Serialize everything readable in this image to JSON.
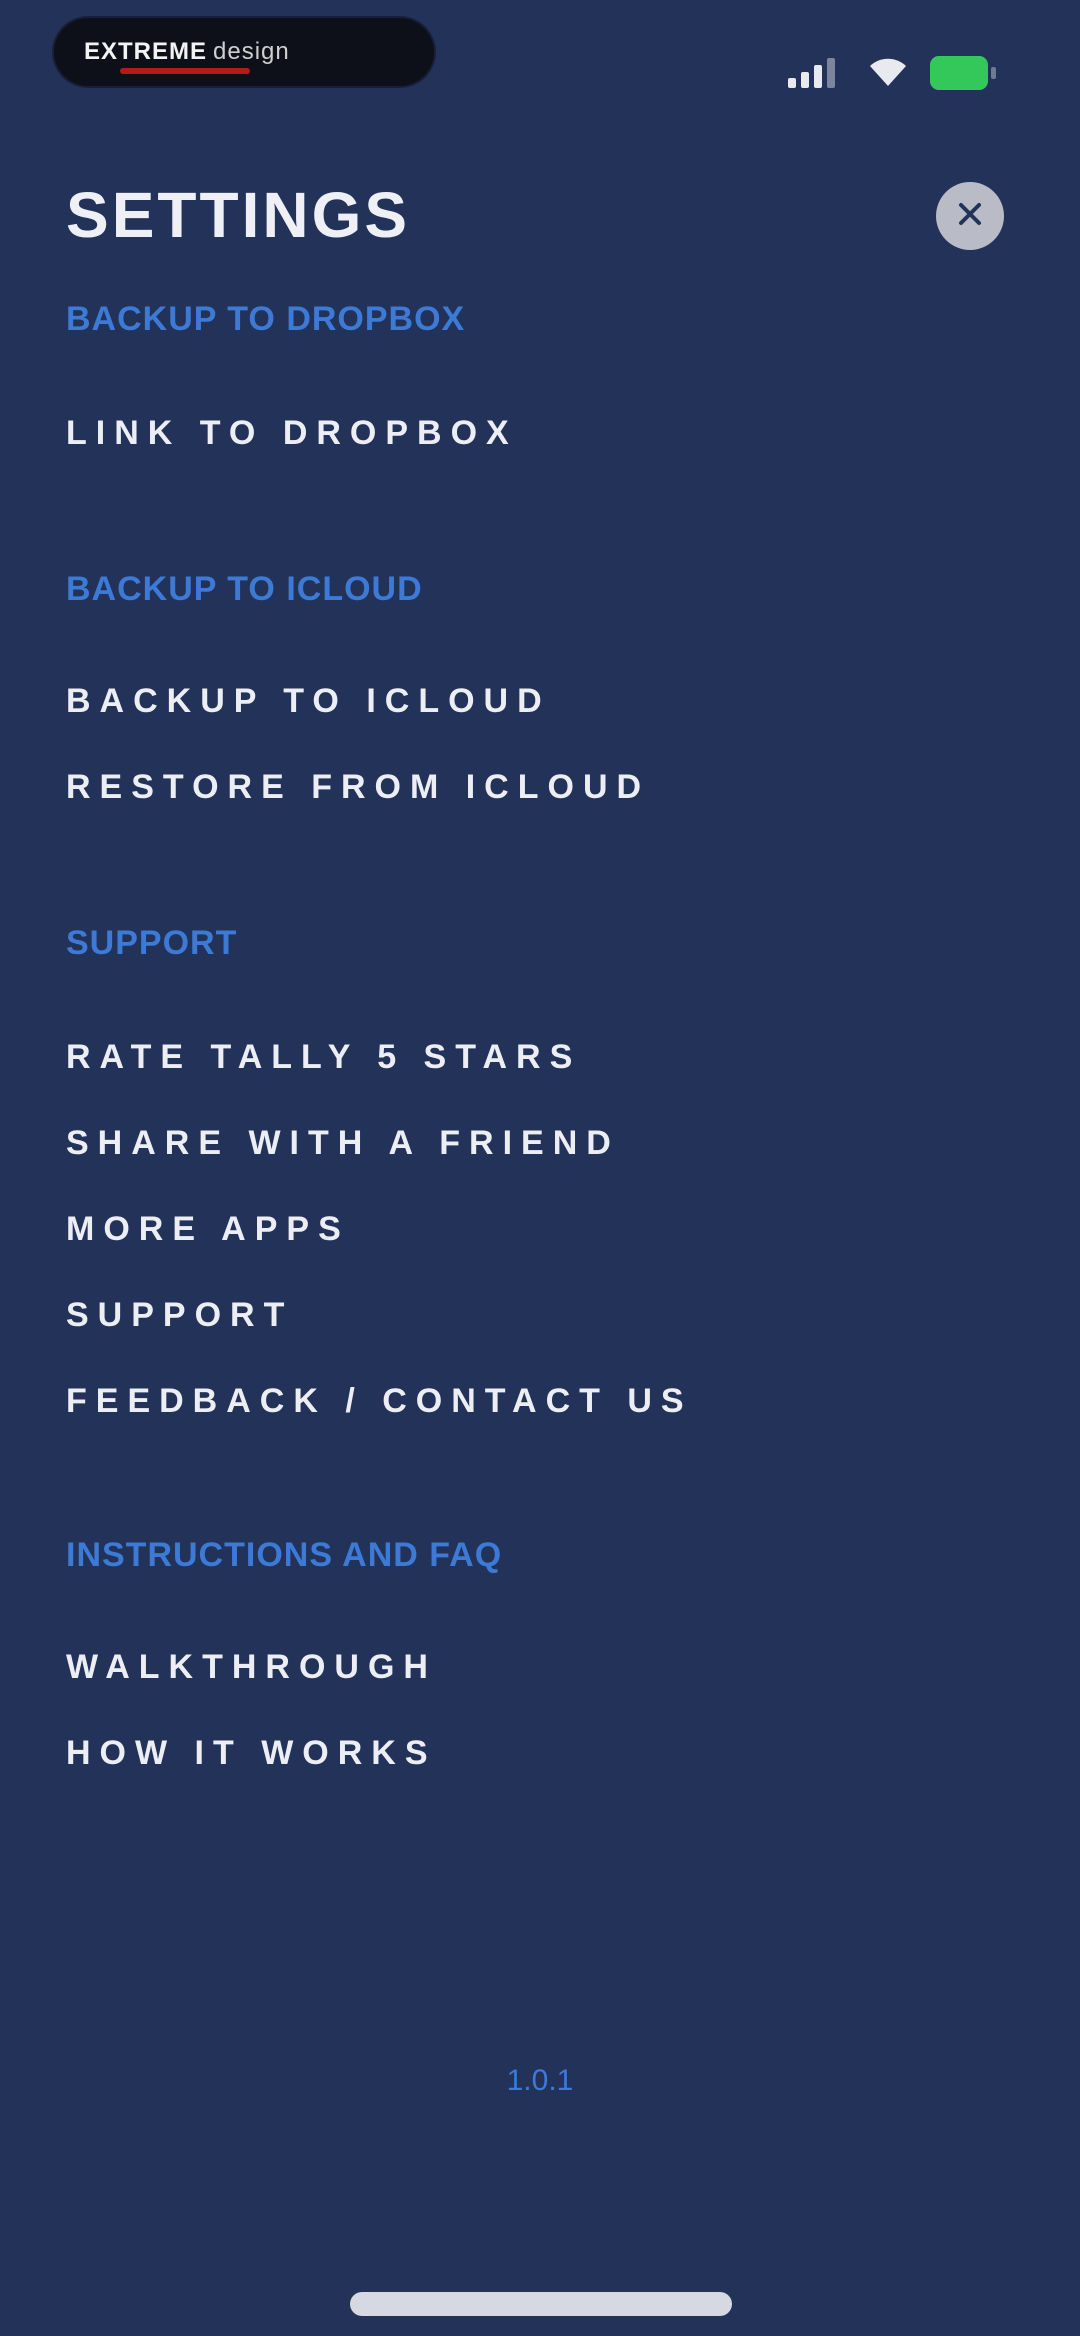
{
  "status_bar": {
    "app_badge_title": "EXTREME",
    "app_badge_subtitle": "design",
    "battery_level": 1.0,
    "battery_color": "#34c759"
  },
  "header": {
    "title": "SETTINGS",
    "close_icon": "close-icon"
  },
  "sections": {
    "dropbox": {
      "header": "BACKUP TO DROPBOX",
      "items": [
        "LINK TO DROPBOX"
      ]
    },
    "icloud": {
      "header": "BACKUP TO ICLOUD",
      "items": [
        "BACKUP TO ICLOUD",
        "RESTORE FROM ICLOUD"
      ]
    },
    "support": {
      "header": "SUPPORT",
      "items": [
        "RATE TALLY 5 STARS",
        "SHARE WITH A FRIEND",
        "MORE APPS",
        "SUPPORT",
        "FEEDBACK / CONTACT US"
      ]
    },
    "instructions": {
      "header": "INSTRUCTIONS AND FAQ",
      "items": [
        "WALKTHROUGH",
        "HOW IT WORKS"
      ]
    }
  },
  "footer": {
    "version": "1.0.1"
  },
  "colors": {
    "background": "#233259",
    "section_header": "#3c7ad6",
    "item_text": "#eceef4"
  }
}
